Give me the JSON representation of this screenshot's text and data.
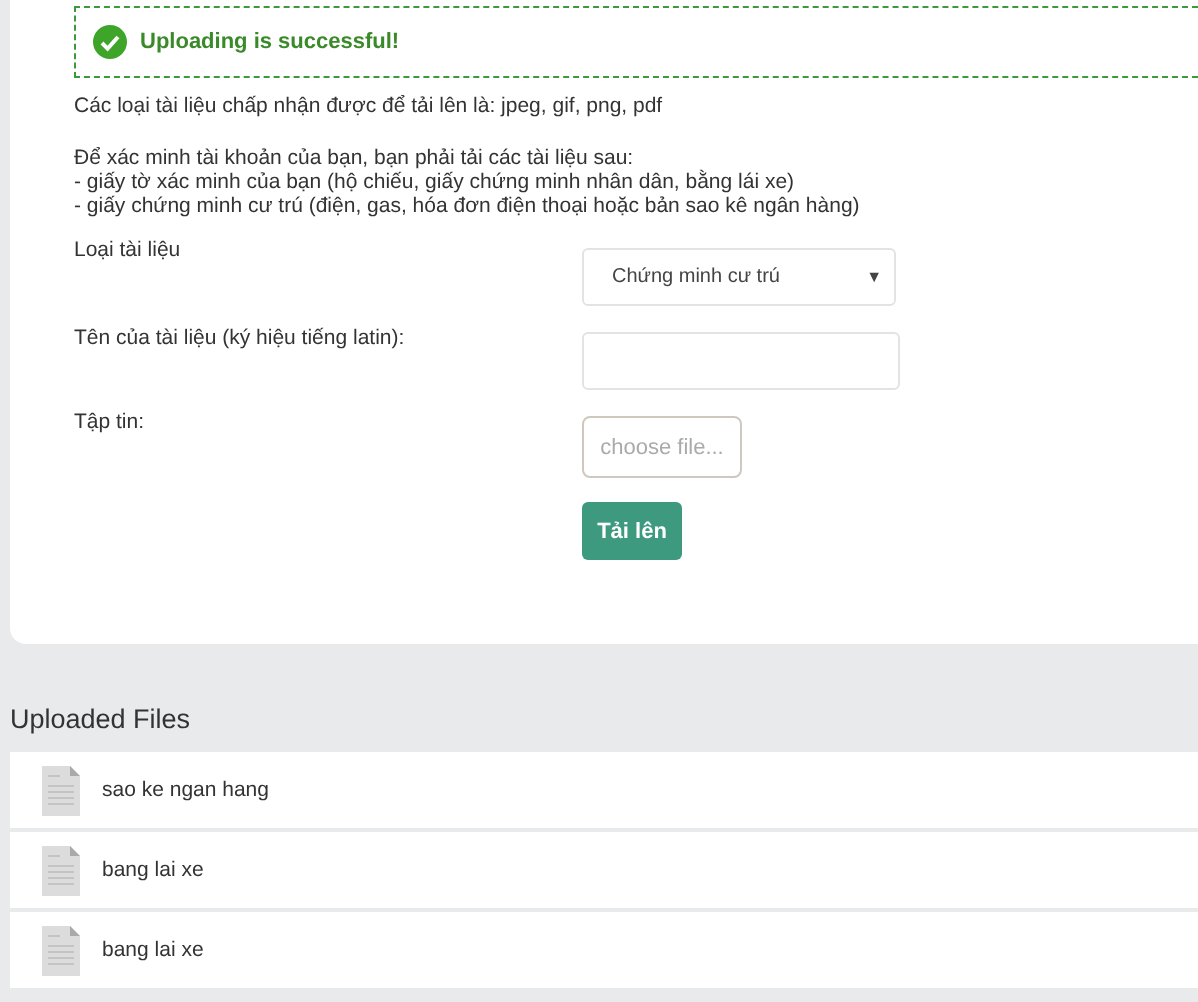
{
  "alert": {
    "message": "Uploading is successful!"
  },
  "info": {
    "accepted": "Các loại tài liệu chấp nhận được để tải lên là: jpeg, gif, png, pdf",
    "intro": "Để xác minh tài khoản của bạn, bạn phải tải các tài liệu sau:",
    "requirements": [
      "- giấy tờ xác minh của bạn (hộ chiếu, giấy chứng minh nhân dân, bằng lái xe)",
      "- giấy chứng minh cư trú (điện, gas, hóa đơn điện thoại hoặc bản sao kê ngân hàng)"
    ]
  },
  "form": {
    "fields": [
      {
        "kind": "select",
        "label": "Loại tài liệu",
        "value": "Chứng minh cư trú",
        "caret": "▼"
      },
      {
        "kind": "text",
        "label": "Tên của tài liệu (ký hiệu tiếng latin):"
      },
      {
        "kind": "file",
        "label": "Tập tin:",
        "placeholder": "choose file..."
      }
    ],
    "submit": "Tải lên"
  },
  "uploaded": {
    "title": "Uploaded Files",
    "files": [
      {
        "name": "sao ke ngan hang"
      },
      {
        "name": "bang lai xe"
      },
      {
        "name": "bang lai xe"
      }
    ]
  }
}
